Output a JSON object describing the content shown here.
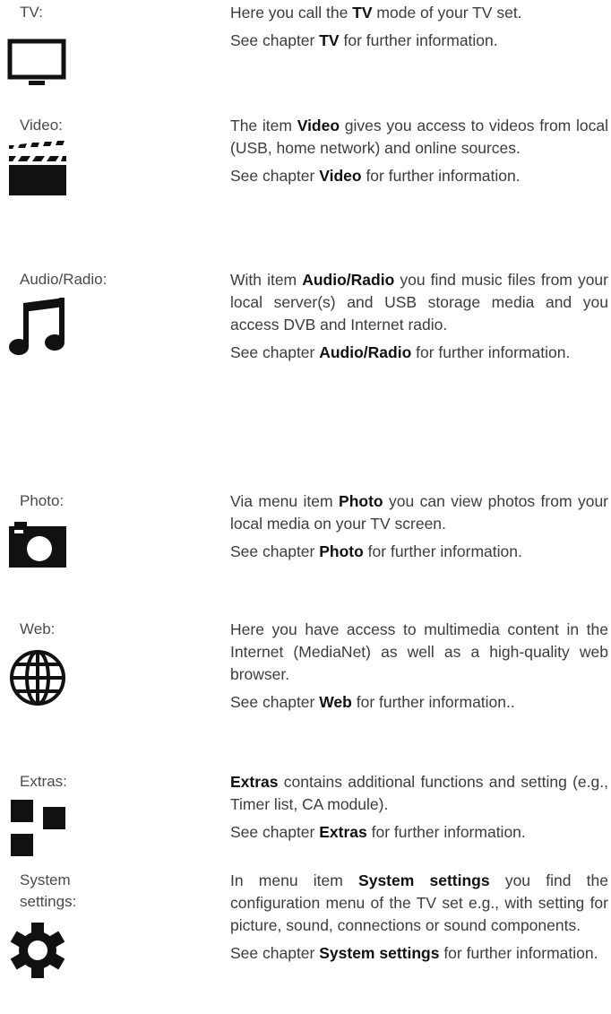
{
  "entries": [
    {
      "label": "TV:",
      "icon": "tv-icon",
      "desc": [
        [
          "Here you call the ",
          "TV",
          " mode of your TV set."
        ],
        [
          "See chapter ",
          "TV",
          " for further information."
        ]
      ]
    },
    {
      "label": "Video:",
      "icon": "clapperboard-icon",
      "desc": [
        [
          "The item ",
          "Video",
          " gives you access to videos from local (USB, home network) and online sources."
        ],
        [
          "See chapter ",
          "Video",
          " for further information."
        ]
      ]
    },
    {
      "label": "Audio/Radio:",
      "icon": "music-note-icon",
      "desc": [
        [
          "With item ",
          "Audio/Radio",
          " you find music files from your local server(s) and USB storage media and you access DVB and Internet radio."
        ],
        [
          "See chapter ",
          "Audio/Radio",
          " for further information."
        ]
      ]
    },
    {
      "label": "Photo:",
      "icon": "camera-icon",
      "desc": [
        [
          "Via menu item ",
          "Photo",
          " you can view photos from your local media on your TV screen."
        ],
        [
          "See chapter ",
          "Photo",
          " for further information."
        ]
      ]
    },
    {
      "label": "Web:",
      "icon": "globe-icon",
      "desc": [
        [
          "Here you have access to multimedia content in the Internet (MediaNet) as well as a high-quality web browser."
        ],
        [
          "See chapter ",
          "Web",
          " for further information.."
        ]
      ]
    },
    {
      "label": "Extras:",
      "icon": "squares-icon",
      "desc": [
        [
          "",
          "Extras",
          " contains additional functions and setting (e.g., Timer list, CA module)."
        ],
        [
          "See chapter ",
          "Extras",
          " for further information."
        ]
      ]
    },
    {
      "label": "System settings:",
      "icon": "gear-icon",
      "desc": [
        [
          "In menu item ",
          "System settings",
          " you find the configuration menu of the TV set e.g., with setting for picture, sound, connections or sound components."
        ],
        [
          "See chapter ",
          "System settings",
          " for further information."
        ]
      ]
    }
  ]
}
